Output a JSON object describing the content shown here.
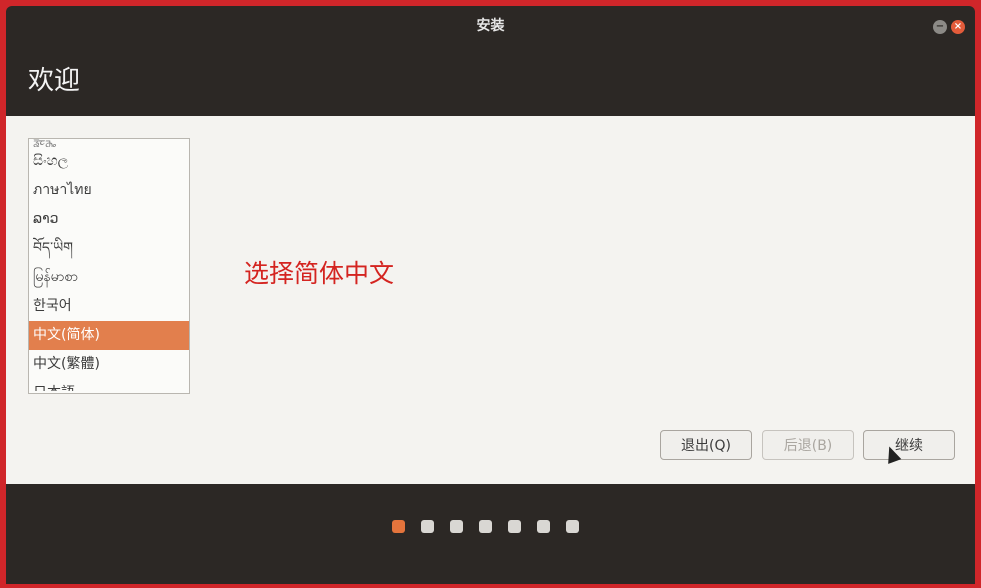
{
  "window": {
    "title": "安装",
    "controls": {
      "minimize": "−",
      "close": "×"
    }
  },
  "header": {
    "title": "欢迎"
  },
  "language_list": {
    "items": [
      {
        "label": "ᤕᤠᤰᤌᤢᤱ",
        "state": "partial"
      },
      {
        "label": "සිංහල"
      },
      {
        "label": "ภาษาไทย"
      },
      {
        "label": "ລາວ"
      },
      {
        "label": "བོད་ཡིག"
      },
      {
        "label": "မြန်မာစာ"
      },
      {
        "label": "한국어"
      },
      {
        "label": "中文(简体)",
        "selected": true
      },
      {
        "label": "中文(繁體)"
      },
      {
        "label": "日本語",
        "state": "partial"
      }
    ]
  },
  "annotation": {
    "text": "选择简体中文",
    "color": "#d42420"
  },
  "buttons": {
    "quit": "退出(Q)",
    "back": "后退(B)",
    "continue": "继续"
  },
  "progress": {
    "total_steps": 7,
    "current_step": 1
  },
  "colors": {
    "accent": "#e27f4d",
    "background": "#d0262a"
  }
}
